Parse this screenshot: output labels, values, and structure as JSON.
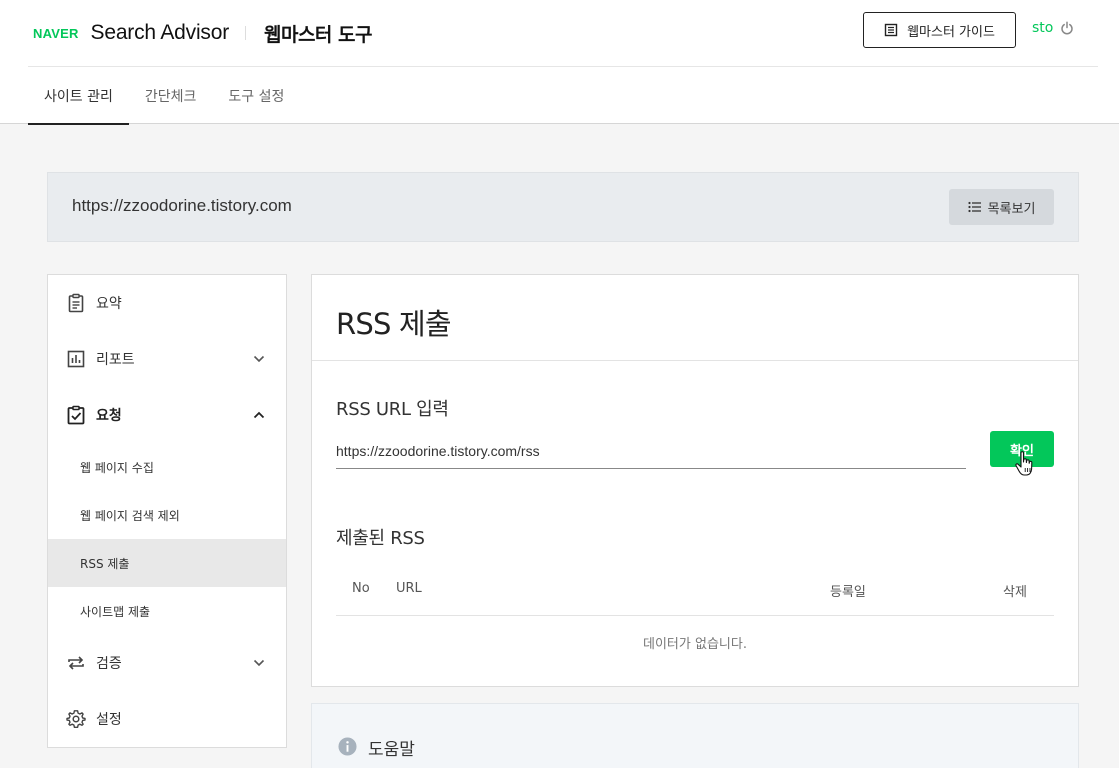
{
  "header": {
    "logo_text": "NAVER",
    "brand": "Search Advisor",
    "tool_name": "웹마스터 도구",
    "guide_button": "웹마스터 가이드",
    "user": "sto"
  },
  "tabs": [
    {
      "label": "사이트 관리",
      "active": true
    },
    {
      "label": "간단체크",
      "active": false
    },
    {
      "label": "도구 설정",
      "active": false
    }
  ],
  "site": {
    "url": "https://zzoodorine.tistory.com",
    "list_button": "목록보기"
  },
  "sidebar": {
    "items": [
      {
        "label": "요약",
        "icon": "clipboard-icon"
      },
      {
        "label": "리포트",
        "icon": "chart-icon"
      },
      {
        "label": "요청",
        "icon": "clipboard-check-icon"
      },
      {
        "label": "검증",
        "icon": "repeat-icon"
      },
      {
        "label": "설정",
        "icon": "gear-icon"
      }
    ],
    "sub_items": [
      {
        "label": "웹 페이지 수집"
      },
      {
        "label": "웹 페이지 검색 제외"
      },
      {
        "label": "RSS 제출",
        "active": true
      },
      {
        "label": "사이트맵 제출"
      }
    ]
  },
  "main": {
    "title": "RSS 제출",
    "input_label": "RSS URL 입력",
    "input_value": "https://zzoodorine.tistory.com/rss",
    "confirm_button": "확인",
    "submitted_label": "제출된 RSS",
    "table": {
      "headers": {
        "no": "No",
        "url": "URL",
        "date": "등록일",
        "delete": "삭제"
      },
      "empty_text": "데이터가 없습니다."
    }
  },
  "help": {
    "title": "도움말"
  },
  "colors": {
    "accent": "#03c75a",
    "page_bg": "#f5f5f5",
    "site_bar_bg": "#e9ecef"
  }
}
